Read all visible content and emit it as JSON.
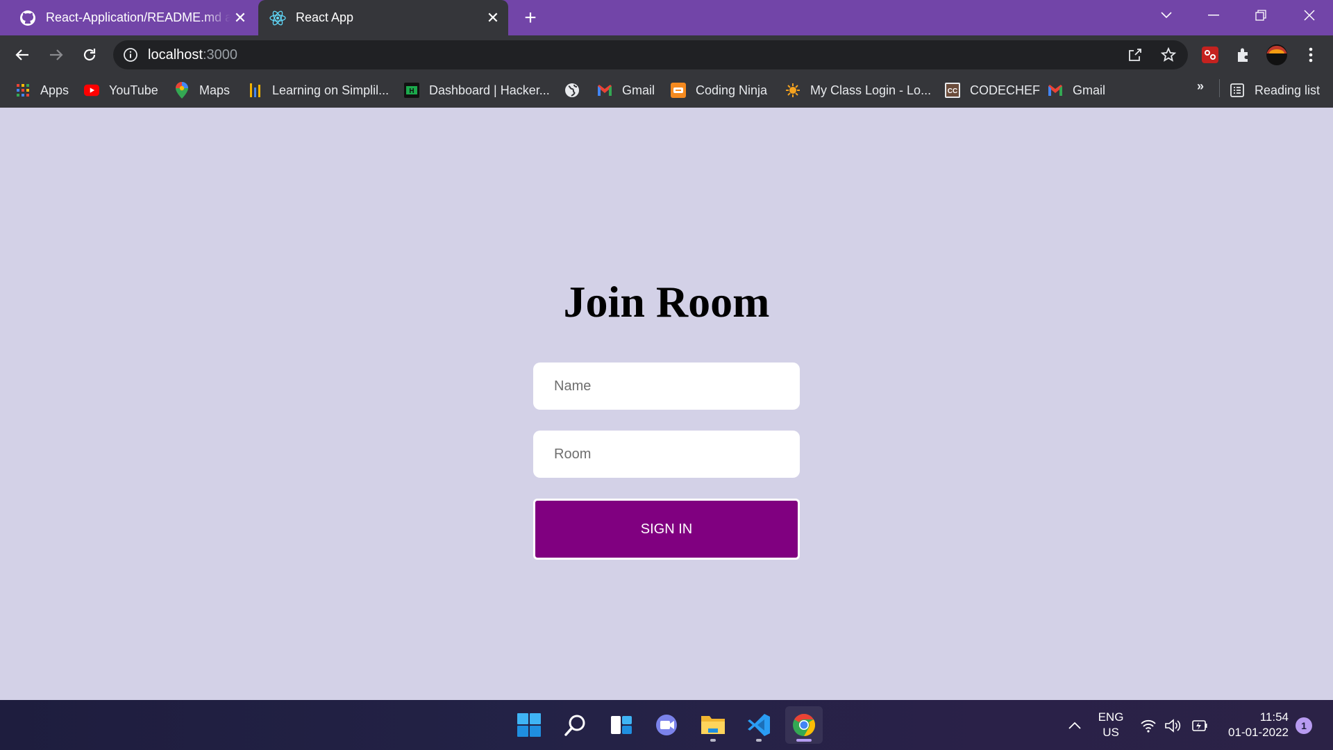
{
  "browser": {
    "tabs": [
      {
        "title": "React-Application/README.md at",
        "icon": "github-icon",
        "active": false
      },
      {
        "title": "React App",
        "icon": "react-icon",
        "active": true
      }
    ],
    "new_tab_label": "+",
    "address": {
      "host": "localhost",
      "port": ":3000"
    },
    "bookmarks": [
      {
        "label": "Apps",
        "icon": "apps-grid-icon"
      },
      {
        "label": "YouTube",
        "icon": "youtube-icon"
      },
      {
        "label": "Maps",
        "icon": "maps-pin-icon"
      },
      {
        "label": "Learning on Simplil...",
        "icon": "simplilearn-icon"
      },
      {
        "label": "Dashboard | Hacker...",
        "icon": "hackerrank-icon"
      },
      {
        "label": "",
        "icon": "globe-icon"
      },
      {
        "label": "Gmail",
        "icon": "gmail-icon"
      },
      {
        "label": "Coding Ninja",
        "icon": "coding-ninjas-icon"
      },
      {
        "label": "My Class Login - Lo...",
        "icon": "sun-icon"
      },
      {
        "label": "CODECHEF",
        "icon": "codechef-icon"
      },
      {
        "label": "Gmail",
        "icon": "gmail-icon"
      }
    ],
    "overflow_label": "»",
    "reading_list_label": "Reading list"
  },
  "page": {
    "heading": "Join Room",
    "name_placeholder": "Name",
    "room_placeholder": "Room",
    "signin_label": "SIGN IN",
    "colors": {
      "background": "#d3d1e7",
      "button": "#800080"
    }
  },
  "taskbar": {
    "apps": [
      "start-icon",
      "search-icon",
      "widgets-icon",
      "teams-chat-icon",
      "file-explorer-icon",
      "vscode-icon",
      "chrome-icon"
    ],
    "language": {
      "line1": "ENG",
      "line2": "US"
    },
    "time": "11:54",
    "date": "01-01-2022",
    "notification_count": "1"
  }
}
